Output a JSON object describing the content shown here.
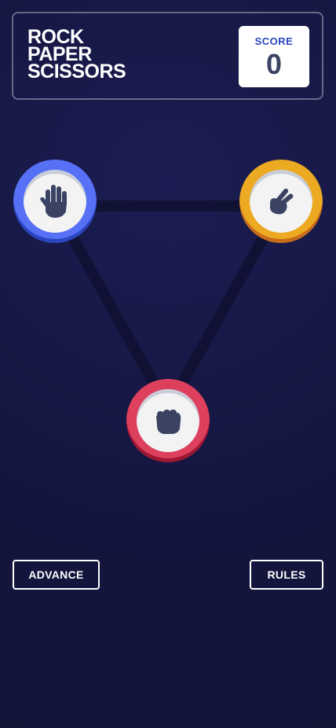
{
  "header": {
    "title_lines": [
      "ROCK",
      "PAPER",
      "SCISSORS"
    ],
    "score_label": "SCORE",
    "score_value": "0"
  },
  "tokens": [
    {
      "choice": "paper",
      "icon": "hand-paper-icon",
      "color": "#5671f5"
    },
    {
      "choice": "scissors",
      "icon": "hand-scissors-icon",
      "color": "#eca922"
    },
    {
      "choice": "rock",
      "icon": "hand-rock-icon",
      "color": "#dd405d"
    }
  ],
  "buttons": {
    "advance_label": "ADVANCE",
    "rules_label": "RULES"
  }
}
